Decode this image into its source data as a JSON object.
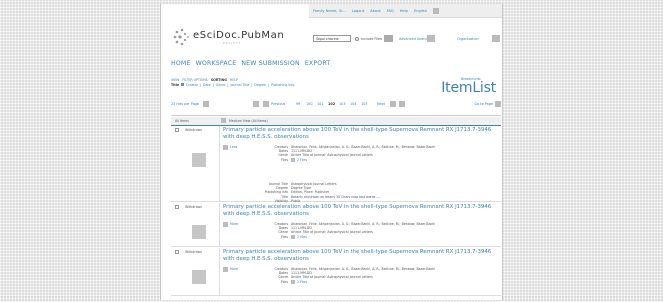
{
  "meta_nav": {
    "family_name": "Family Name, Gi...",
    "logout": "Logout",
    "about": "About",
    "faq": "FAQ",
    "help": "Help",
    "language": "English"
  },
  "header": {
    "logo_text": "eSciDoc.PubMan",
    "logo_sub": "PROJECT",
    "quicksearch_value": "Sepol chlorine",
    "include_files": "Include Files",
    "advanced_search": "Advanced Search",
    "organization": "Organization"
  },
  "main_nav": [
    "HOME",
    "WORKSPACE",
    "NEW SUBMISSION",
    "EXPORT"
  ],
  "sub_nav": {
    "items": [
      "VIEW",
      "FILTER OPTIONS",
      "SORTING",
      "HELP"
    ],
    "active_index": 2
  },
  "sorting": {
    "current": "Title",
    "options": [
      "Creator",
      "Date",
      "Genre",
      "Journal Title",
      "Degree",
      "Publishing Info"
    ]
  },
  "breadcrumb": "Breadcrumb",
  "page_title": "ItemList",
  "pager": {
    "hits_per_page": "25 Hits per Page",
    "previous": "Previous",
    "pages": [
      "99",
      "100",
      "101",
      "102",
      "103",
      "104",
      "105"
    ],
    "current_page": "102",
    "next": "Next",
    "goto": "Go to Page"
  },
  "list_header": {
    "all_items": "All Items",
    "medium_view": "Medium View (All Items)"
  },
  "items": [
    {
      "status": "Withdrawn",
      "title": "Primary particle acceleration above 100 TeV in the shell-type Supernova Remnant RX J1713.7-3946 with deep H.E.S.S. observations",
      "more": "Less",
      "creators": "Aharonian, Felix; Akhperjanian, A. G.; Bazer-Bachi, A. R.; Beilicke, M.; Benbow; Bazer-Bachi",
      "dates": "1111-MM-DD",
      "genre": "Article Title of Journal: Astrophysical Journal Letters",
      "files": "2 Files",
      "expanded": true,
      "journal_title": "Astrophysical Journal Letters",
      "degree": "Degree Type",
      "publishing_info": "Edition, Place: Publisher",
      "title_detail": "Botanic excursion on beans 30 Chars crop last words ....",
      "visibility": "Public"
    },
    {
      "status": "Withdrawn",
      "title": "Primary particle acceleration above 100 TeV in the shell-type Supernova Remnant RX J1713.7-3946 with deep H.E.S.S. observations",
      "more": "More",
      "creators": "Aharonian, Felix; Akhperjanian, A. G.; Bazer-Bachi, A. R.; Beilicke, M.; Benbow; Bazer-Bachi",
      "dates": "1111-MM-DD",
      "genre": "Article Title of Journal: Astrophysical Journal Letters",
      "files": "2 Files",
      "expanded": false
    },
    {
      "status": "Withdrawn",
      "title": "Primary particle acceleration above 100 TeV in the shell-type Supernova Remnant RX J1713.7-3946 with deep H.E.S.S. observations",
      "more": "More",
      "creators": "Aharonian, Felix; Akhperjanian, A. G.; Bazer-Bachi, A. R.; Beilicke, M.; Benbow; Bazer-Bachi",
      "dates": "1111-MM-DD",
      "genre": "Article Title of Journal: Astrophysical Journal Letters",
      "files": "2 Files",
      "expanded": false
    }
  ],
  "labels": {
    "creators": "Creators",
    "dates": "Dates",
    "genre": "Genre",
    "files": "Files",
    "journal_title": "Journal Title",
    "degree": "Degree",
    "publishing_info": "Publishing Info",
    "title": "Title",
    "visibility": "Visibility"
  },
  "colors": {
    "link": "#3a84b4",
    "text": "#555555",
    "button": "#bbbbbb"
  }
}
